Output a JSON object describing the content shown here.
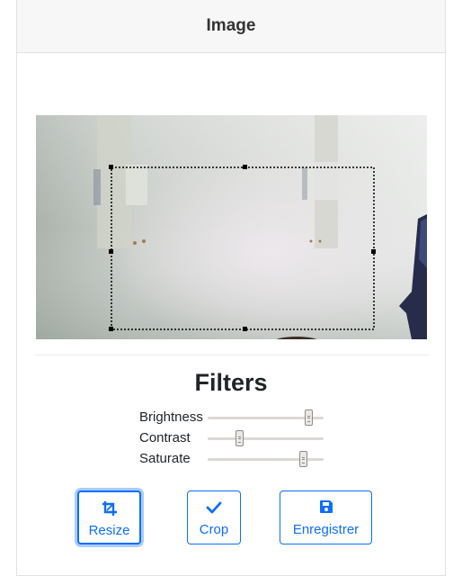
{
  "header": {
    "title": "Image"
  },
  "image": {
    "description_icon": "photo-preview"
  },
  "filters": {
    "title": "Filters",
    "items": [
      {
        "label": "Brightness",
        "value": 0.9
      },
      {
        "label": "Contrast",
        "value": 0.26
      },
      {
        "label": "Saturate",
        "value": 0.85
      }
    ]
  },
  "actions": {
    "resize_label": "Resize",
    "crop_label": "Crop",
    "save_label": "Enregistrer"
  },
  "colors": {
    "accent": "#0d6efd",
    "header_bg": "#f7f7f7"
  }
}
